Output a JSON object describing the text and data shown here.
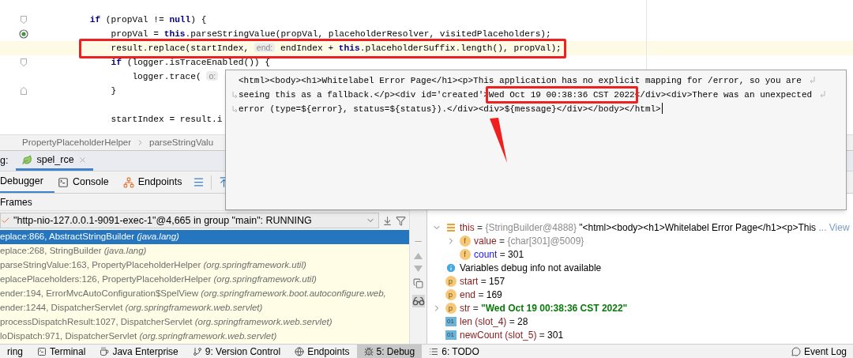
{
  "editor": {
    "lines": [
      {
        "kind": "code",
        "current": false,
        "annotated": false,
        "tokens": [
          {
            "kind": "keyword",
            "text": "if"
          },
          {
            "kind": "code",
            "text": " (propVal != "
          },
          {
            "kind": "keyword",
            "text": "null"
          },
          {
            "kind": "code",
            "text": ") {"
          }
        ],
        "children": [
          {
            "kind": "code",
            "current": false,
            "annotated": false,
            "tokens": [
              {
                "kind": "code",
                "text": "propVal = "
              },
              {
                "kind": "keyword",
                "text": "this"
              },
              {
                "kind": "code",
                "text": ".parseStringValue(propVal, placeholderResolver, visitedPlaceholders);"
              }
            ]
          },
          {
            "kind": "code",
            "current": true,
            "annotated": true,
            "tokens": [
              {
                "kind": "code",
                "text": "result.replace(startIndex, "
              },
              {
                "kind": "hint",
                "text": "end:"
              },
              {
                "kind": "code",
                "text": " endIndex + "
              },
              {
                "kind": "keyword",
                "text": "this"
              },
              {
                "kind": "code",
                "text": ".placeholderSuffix.length(), propVal);"
              }
            ]
          },
          {
            "kind": "code",
            "current": false,
            "annotated": false,
            "tokens": [
              {
                "kind": "keyword",
                "text": "if"
              },
              {
                "kind": "code",
                "text": " (logger.isTraceEnabled()) {"
              }
            ],
            "children": [
              {
                "kind": "code",
                "current": false,
                "annotated": false,
                "tokens": [
                  {
                    "kind": "code",
                    "text": "logger.trace( "
                  },
                  {
                    "kind": "hint",
                    "text": "o:"
                  }
                ]
              }
            ]
          },
          {
            "kind": "code",
            "current": false,
            "annotated": false,
            "tokens": [
              {
                "kind": "code",
                "text": "}"
              }
            ]
          },
          {
            "kind": "blank",
            "current": false,
            "annotated": false
          },
          {
            "kind": "code",
            "current": false,
            "annotated": false,
            "tokens": [
              {
                "kind": "code",
                "text": "startIndex = result.i"
              }
            ]
          }
        ]
      }
    ]
  },
  "breadcrumb": [
    "PropertyPlaceholderHelper",
    "parseStringValu"
  ],
  "debug_session": {
    "label": "g:",
    "tabs": [
      {
        "title": "spel_rce",
        "selected": true
      }
    ]
  },
  "debug_tabs": [
    {
      "label": "Debugger",
      "selected": true
    },
    {
      "label": "Console",
      "selected": false
    },
    {
      "label": "Endpoints",
      "selected": false
    }
  ],
  "frames": {
    "title": "Frames",
    "thread": "\"http-nio-127.0.0.1-9091-exec-1\"@4,665 in group \"main\": RUNNING",
    "items": [
      {
        "text": "eplace:866, AbstractStringBuilder *(java.lang)*",
        "selected": true
      },
      {
        "text": "eplace:268, StringBuilder *(java.lang)*",
        "selected": false
      },
      {
        "text": "parseStringValue:163, PropertyPlaceholderHelper *(org.springframework.util)*",
        "selected": false
      },
      {
        "text": "eplacePlaceholders:126, PropertyPlaceholderHelper *(org.springframework.util)*",
        "selected": false
      },
      {
        "text": "ender:194, ErrorMvcAutoConfiguration$SpelView *(org.springframework.boot.autoconfigure.web,*",
        "selected": false
      },
      {
        "text": "ender:1244, DispatcherServlet *(org.springframework.web.servlet)*",
        "selected": false
      },
      {
        "text": "processDispatchResult:1027, DispatcherServlet *(org.springframework.web.servlet)*",
        "selected": false
      },
      {
        "text": "loDispatch:971, DispatcherServlet *(org.springframework.web.servlet)*",
        "selected": false
      }
    ]
  },
  "variables": [
    {
      "kind": "object",
      "name": "this",
      "op": "=",
      "type": "{StringBuilder@4888}",
      "value": "\"<html><body><h1>Whitelabel Error Page</h1><p>This",
      "link": "... View",
      "string_value": false,
      "changed": false,
      "expanded": true,
      "children": [
        {
          "kind": "field",
          "badge": "f",
          "name": "value",
          "op": "=",
          "type": "{char[301]@5009}",
          "changed": false,
          "expanded": false
        },
        {
          "kind": "field",
          "badge": "f",
          "name": "count",
          "op": "=",
          "value": "301",
          "string_value": false,
          "changed": true
        }
      ]
    },
    {
      "kind": "info",
      "text": "Variables debug info not available"
    },
    {
      "kind": "param",
      "badge": "p",
      "name": "start",
      "op": "=",
      "value": "157",
      "string_value": false,
      "changed": false
    },
    {
      "kind": "param",
      "badge": "p",
      "name": "end",
      "op": "=",
      "value": "169",
      "string_value": false,
      "changed": false
    },
    {
      "kind": "param",
      "badge": "p",
      "name": "str",
      "op": "=",
      "value": "\"Wed Oct 19 00:38:36 CST 2022\"",
      "string_value": true,
      "changed": false,
      "expanded": false
    },
    {
      "kind": "local",
      "badge": "01",
      "name": "len (slot_4)",
      "op": "=",
      "value": "28",
      "string_value": false,
      "changed": false
    },
    {
      "kind": "local",
      "badge": "01",
      "name": "newCount (slot_5)",
      "op": "=",
      "value": "301",
      "string_value": false,
      "changed": false
    }
  ],
  "popup": {
    "lines": [
      {
        "wrapped": true,
        "tokens": [
          {
            "text": "<html><body><h1>Whitelabel Error Page</h1><p>This application has no explicit mapping for /error, so you are",
            "boxed": false
          }
        ]
      },
      {
        "wrapped": true,
        "tokens": [
          {
            "text": "seeing this as a fallback.</p><div id='created'>",
            "boxed": false
          },
          {
            "text": "Wed Oct 19 00:38:36 CST 2022",
            "boxed": true
          },
          {
            "text": "</div><div>There was an unexpected",
            "boxed": false
          }
        ]
      },
      {
        "wrapped": false,
        "tokens": [
          {
            "text": "error (type=${error}, status=${status}).</div><div>${message}</div></body></html>",
            "boxed": false
          }
        ]
      }
    ]
  },
  "bottom_bar": {
    "items": [
      {
        "label": "ring",
        "selected": false
      },
      {
        "label": "Terminal",
        "selected": false
      },
      {
        "label": "Java Enterprise",
        "selected": false
      },
      {
        "label": "9: Version Control",
        "selected": false
      },
      {
        "label": "Endpoints",
        "selected": false
      },
      {
        "label": "5: Debug",
        "selected": true
      },
      {
        "label": "6: TODO",
        "selected": false
      }
    ],
    "right": [
      {
        "label": "Event Log"
      }
    ]
  }
}
